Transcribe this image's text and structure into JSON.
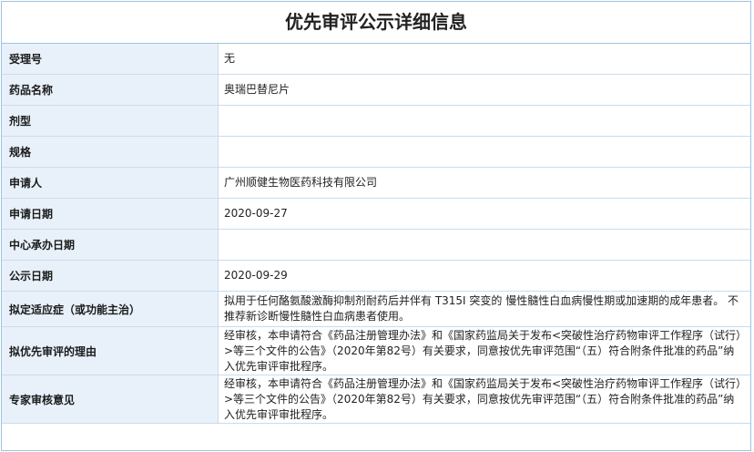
{
  "title": "优先审评公示详细信息",
  "rows": [
    {
      "label": "受理号",
      "value": "无"
    },
    {
      "label": "药品名称",
      "value": "奥瑞巴替尼片"
    },
    {
      "label": "剂型",
      "value": ""
    },
    {
      "label": "规格",
      "value": ""
    },
    {
      "label": "申请人",
      "value": "广州顺健生物医药科技有限公司"
    },
    {
      "label": "申请日期",
      "value": "2020-09-27"
    },
    {
      "label": "中心承办日期",
      "value": ""
    },
    {
      "label": "公示日期",
      "value": "2020-09-29"
    },
    {
      "label": "拟定适应症（或功能主治）",
      "value": "拟用于任何酪氨酸激酶抑制剂耐药后并伴有 T315I 突变的 慢性髓性白血病慢性期或加速期的成年患者。 不推荐新诊断慢性髓性白血病患者使用。"
    },
    {
      "label": "拟优先审评的理由",
      "value": "经审核，本申请符合《药品注册管理办法》和《国家药监局关于发布<突破性治疗药物审评工作程序（试行）>等三个文件的公告》（2020年第82号）有关要求，同意按优先审评范围“（五）符合附条件批准的药品”纳入优先审评审批程序。"
    },
    {
      "label": "专家审核意见",
      "value": "经审核，本申请符合《药品注册管理办法》和《国家药监局关于发布<突破性治疗药物审评工作程序（试行）>等三个文件的公告》（2020年第82号）有关要求，同意按优先审评范围“（五）符合附条件批准的药品”纳入优先审评审批程序。"
    }
  ]
}
